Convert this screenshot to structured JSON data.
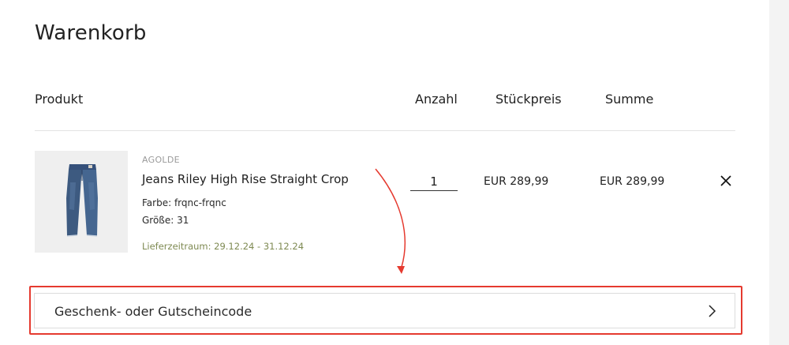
{
  "page": {
    "title": "Warenkorb"
  },
  "table_headers": {
    "product": "Produkt",
    "quantity": "Anzahl",
    "unit_price": "Stückpreis",
    "total": "Summe"
  },
  "cart_item": {
    "brand": "AGOLDE",
    "name": "Jeans Riley High Rise Straight Crop",
    "color": "Farbe: frqnc-frqnc",
    "size": "Größe: 31",
    "delivery": "Lieferzeitraum: 29.12.24 - 31.12.24",
    "quantity": "1",
    "unit_price": "EUR 289,99",
    "total": "EUR 289,99",
    "image_icon": "jeans-product-image",
    "remove_icon": "close-icon"
  },
  "voucher": {
    "label": "Geschenk- oder Gutscheincode",
    "icon": "chevron-right-icon"
  },
  "colors": {
    "delivery_text": "#7e8a52",
    "annotation": "#e53a2f",
    "jeans": "#3d5a80"
  }
}
